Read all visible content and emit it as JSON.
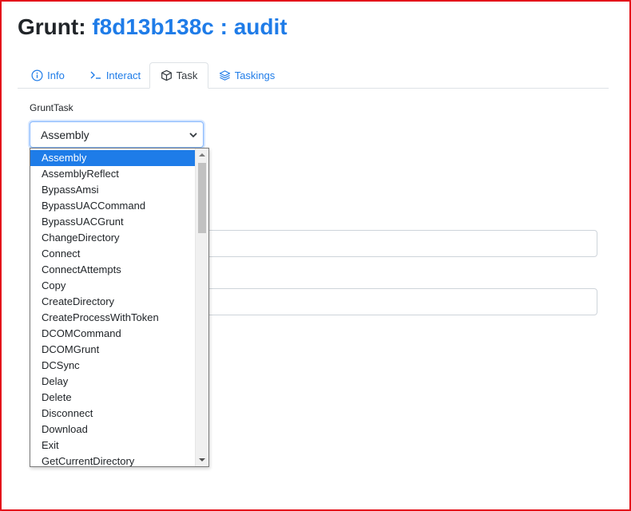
{
  "header": {
    "prefix": "Grunt:",
    "grunt_name": "f8d13b138c : audit"
  },
  "tabs": [
    {
      "label": "Info",
      "icon": "info-icon"
    },
    {
      "label": "Interact",
      "icon": "terminal-icon"
    },
    {
      "label": "Task",
      "icon": "box-icon",
      "active": true
    },
    {
      "label": "Taskings",
      "icon": "layers-icon"
    }
  ],
  "form": {
    "grunttask_label": "GruntTask",
    "selected_task": "Assembly"
  },
  "dropdown_options": [
    "Assembly",
    "AssemblyReflect",
    "BypassAmsi",
    "BypassUACCommand",
    "BypassUACGrunt",
    "ChangeDirectory",
    "Connect",
    "ConnectAttempts",
    "Copy",
    "CreateDirectory",
    "CreateProcessWithToken",
    "DCOMCommand",
    "DCOMGrunt",
    "DCSync",
    "Delay",
    "Delete",
    "Disconnect",
    "Download",
    "Exit",
    "GetCurrentDirectory"
  ],
  "colors": {
    "link": "#1f7ce8",
    "selection": "#1e7ce8",
    "frame": "#e4141b"
  }
}
